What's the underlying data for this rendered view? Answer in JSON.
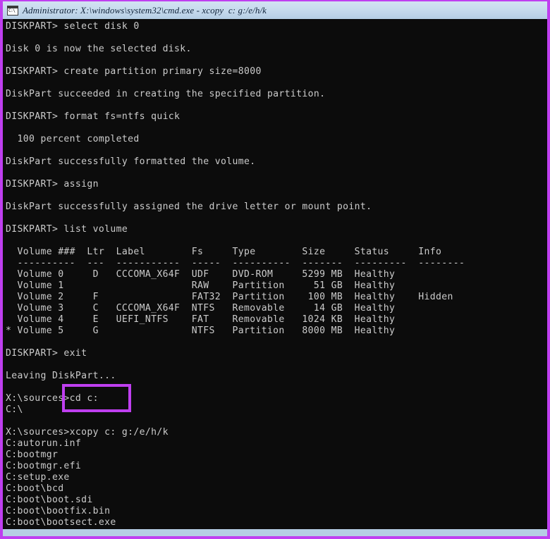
{
  "window": {
    "title": "Administrator: X:\\windows\\system32\\cmd.exe - xcopy  c: g:/e/h/k",
    "icon": "cmd-console-icon",
    "frame_color": "#bf3ff0",
    "titlebar_color": "#c9dcee",
    "console_bg": "#0c0c0c",
    "console_fg": "#cccccc"
  },
  "annotation": {
    "type": "rectangle-highlight",
    "color": "#bf3ff0",
    "targets_text": "cd c:"
  },
  "console": {
    "lines": [
      "DISKPART> select disk 0",
      "",
      "Disk 0 is now the selected disk.",
      "",
      "DISKPART> create partition primary size=8000",
      "",
      "DiskPart succeeded in creating the specified partition.",
      "",
      "DISKPART> format fs=ntfs quick",
      "",
      "  100 percent completed",
      "",
      "DiskPart successfully formatted the volume.",
      "",
      "DISKPART> assign",
      "",
      "DiskPart successfully assigned the drive letter or mount point.",
      "",
      "DISKPART> list volume",
      "",
      "  Volume ###  Ltr  Label        Fs     Type        Size     Status     Info",
      "  ----------  ---  -----------  -----  ----------  -------  ---------  --------",
      "  Volume 0     D   CCCOMA_X64F  UDF    DVD-ROM     5299 MB  Healthy",
      "  Volume 1                      RAW    Partition     51 GB  Healthy",
      "  Volume 2     F                FAT32  Partition    100 MB  Healthy    Hidden",
      "  Volume 3     C   CCCOMA_X64F  NTFS   Removable     14 GB  Healthy",
      "  Volume 4     E   UEFI_NTFS    FAT    Removable   1024 KB  Healthy",
      "* Volume 5     G                NTFS   Partition   8000 MB  Healthy",
      "",
      "DISKPART> exit",
      "",
      "Leaving DiskPart...",
      "",
      "X:\\sources>cd c:",
      "C:\\",
      "",
      "X:\\sources>xcopy c: g:/e/h/k",
      "C:autorun.inf",
      "C:bootmgr",
      "C:bootmgr.efi",
      "C:setup.exe",
      "C:boot\\bcd",
      "C:boot\\boot.sdi",
      "C:boot\\bootfix.bin",
      "C:boot\\bootsect.exe"
    ]
  }
}
